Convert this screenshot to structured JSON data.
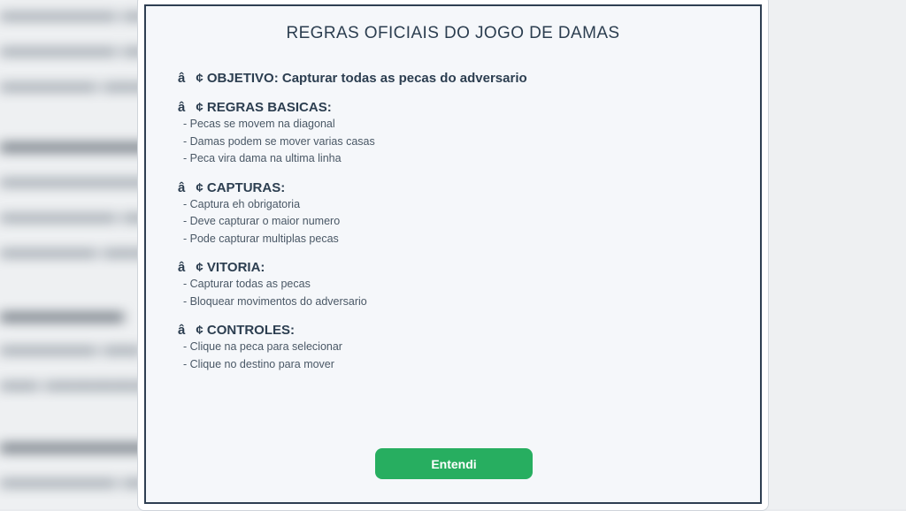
{
  "modal": {
    "title": "REGRAS OFICIAIS DO JOGO DE DAMAS",
    "bullet": "â¢",
    "objective": {
      "label": "OBJETIVO: Capturar todas as pecas do adversario"
    },
    "sections": [
      {
        "title": "REGRAS BASICAS:",
        "items": [
          "- Pecas se movem na diagonal",
          "- Damas podem se mover varias casas",
          "- Peca vira dama na ultima linha"
        ]
      },
      {
        "title": "CAPTURAS:",
        "items": [
          "- Captura eh obrigatoria",
          "- Deve capturar o maior numero",
          "- Pode capturar multiplas pecas"
        ]
      },
      {
        "title": "VITORIA:",
        "items": [
          "- Capturar todas as pecas",
          "- Bloquear movimentos do adversario"
        ]
      },
      {
        "title": "CONTROLES:",
        "items": [
          "- Clique na peca para selecionar",
          "- Clique no destino para mover"
        ]
      }
    ],
    "button_label": "Entendi"
  },
  "colors": {
    "accent_button": "#27ae60",
    "modal_border": "#2f3f52",
    "text_dark": "#2c3e50"
  }
}
